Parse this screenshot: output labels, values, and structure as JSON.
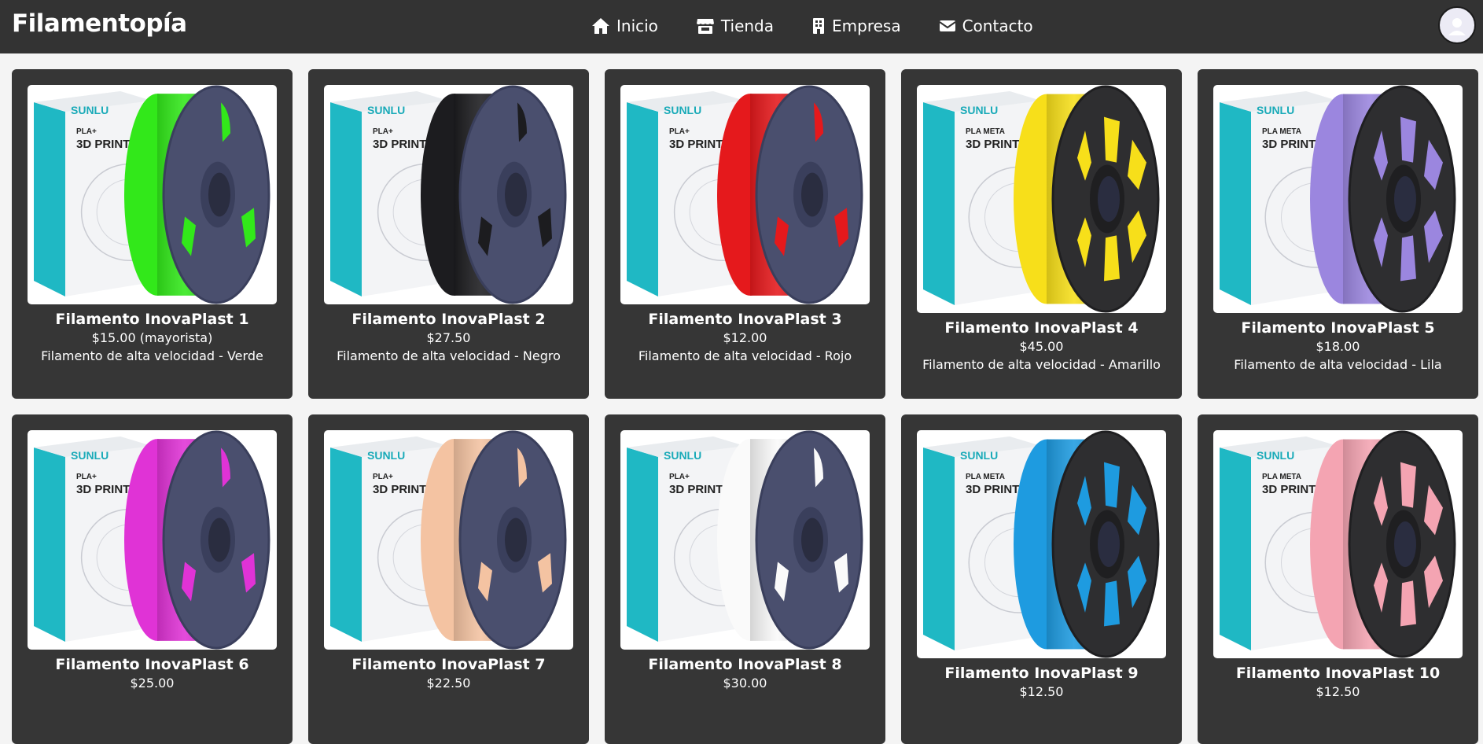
{
  "header": {
    "brand": "Filamentopía",
    "nav": [
      {
        "label": "Inicio",
        "icon": "home-icon"
      },
      {
        "label": "Tienda",
        "icon": "store-icon"
      },
      {
        "label": "Empresa",
        "icon": "building-icon"
      },
      {
        "label": "Contacto",
        "icon": "envelope-icon"
      }
    ],
    "avatar_icon": "user-avatar-icon"
  },
  "colors": {
    "header_bg": "#333333",
    "card_bg": "#363636",
    "page_bg": "#f4f4f4"
  },
  "products": [
    {
      "title": "Filamento InovaPlast 1",
      "price": "$15.00 (mayorista)",
      "desc": "Filamento de alta velocidad - Verde",
      "filament_color": "#32e81a",
      "style": "PLA+"
    },
    {
      "title": "Filamento InovaPlast 2",
      "price": "$27.50",
      "desc": "Filamento de alta velocidad - Negro",
      "filament_color": "#1c1c1f",
      "style": "PLA+"
    },
    {
      "title": "Filamento InovaPlast 3",
      "price": "$12.00",
      "desc": "Filamento de alta velocidad - Rojo",
      "filament_color": "#e5191c",
      "style": "PLA+"
    },
    {
      "title": "Filamento InovaPlast 4",
      "price": "$45.00",
      "desc": "Filamento de alta velocidad - Amarillo",
      "filament_color": "#f7df1a",
      "style": "PLA META"
    },
    {
      "title": "Filamento InovaPlast 5",
      "price": "$18.00",
      "desc": "Filamento de alta velocidad - Lila",
      "filament_color": "#9b86df",
      "style": "PLA META"
    },
    {
      "title": "Filamento InovaPlast 6",
      "price": "$25.00",
      "desc": "",
      "filament_color": "#e033d6",
      "style": "PLA+"
    },
    {
      "title": "Filamento InovaPlast 7",
      "price": "$22.50",
      "desc": "",
      "filament_color": "#f4c3a2",
      "style": "PLA+"
    },
    {
      "title": "Filamento InovaPlast 8",
      "price": "$30.00",
      "desc": "",
      "filament_color": "#fafafa",
      "style": "PLA+"
    },
    {
      "title": "Filamento InovaPlast 9",
      "price": "$12.50",
      "desc": "",
      "filament_color": "#1e9be0",
      "style": "PLA META"
    },
    {
      "title": "Filamento InovaPlast 10",
      "price": "$12.50",
      "desc": "",
      "filament_color": "#f4a4b2",
      "style": "PLA META"
    }
  ],
  "box": {
    "brand": "SUNLU",
    "line1_plus": "PLA+",
    "line1_meta": "PLA META",
    "line2": "3D PRINTIN"
  }
}
